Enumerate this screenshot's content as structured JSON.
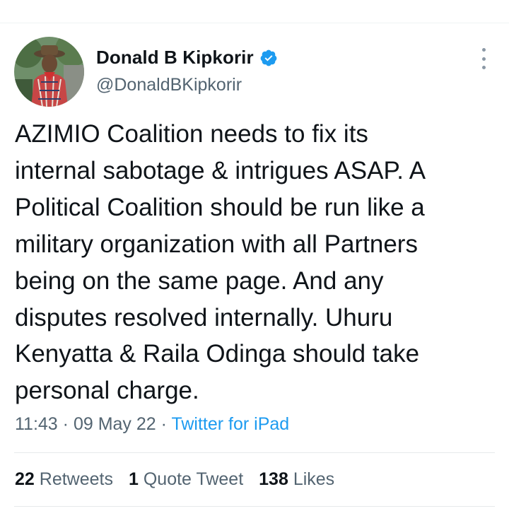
{
  "author": {
    "display_name": "Donald B Kipkorir",
    "handle": "@DonaldBKipkorir",
    "verified": true,
    "avatar_icon": "profile-photo"
  },
  "tweet": {
    "text": "AZIMIO Coalition needs to fix its\ninternal sabotage & intrigues ASAP. A\nPolitical Coalition should be run like a\nmilitary organization with all Partners\nbeing on the same page. And any\ndisputes resolved internally. Uhuru\nKenyatta & Raila Odinga should take\npersonal charge."
  },
  "meta": {
    "time": "11:43",
    "separator": " · ",
    "date": "09 May 22",
    "source": "Twitter for iPad"
  },
  "stats": {
    "retweets_count": "22",
    "retweets_label": "Retweets",
    "quotes_count": "1",
    "quotes_label": "Quote Tweet",
    "likes_count": "138",
    "likes_label": "Likes"
  },
  "colors": {
    "accent": "#1d9bf0",
    "secondary_text": "#536471",
    "primary_text": "#0f1419"
  },
  "icons": {
    "verified": "verified-badge-icon",
    "more": "more-options-icon"
  }
}
